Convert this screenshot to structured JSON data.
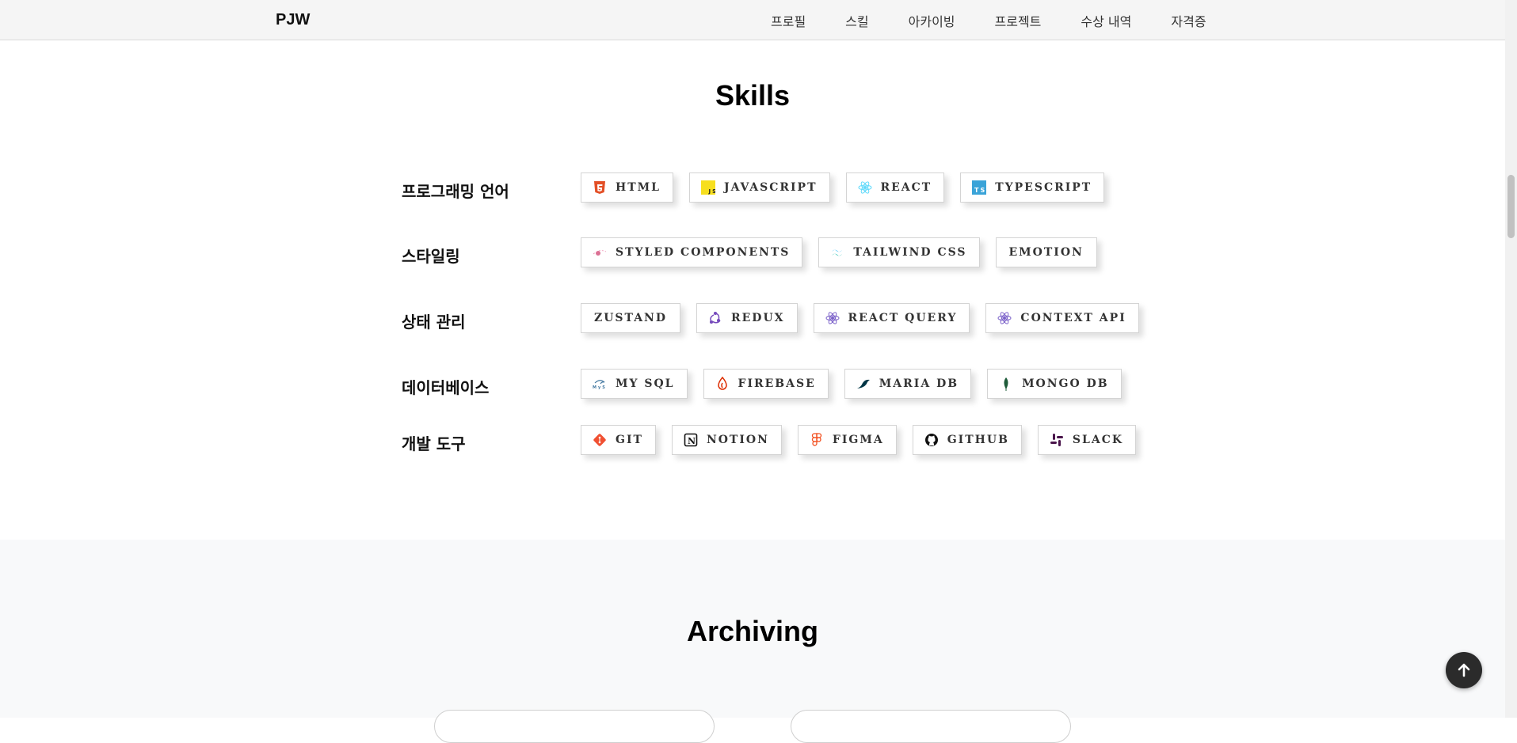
{
  "header": {
    "logo": "PJW",
    "nav": [
      "프로필",
      "스킬",
      "아카이빙",
      "프로젝트",
      "수상 내역",
      "자격증"
    ]
  },
  "skills": {
    "title": "Skills",
    "rows": [
      {
        "category": "프로그래밍 언어",
        "items": [
          {
            "label": "HTML",
            "icon": "html5-icon"
          },
          {
            "label": "JAVASCRIPT",
            "icon": "javascript-icon"
          },
          {
            "label": "REACT",
            "icon": "react-icon"
          },
          {
            "label": "TYPESCRIPT",
            "icon": "typescript-icon"
          }
        ]
      },
      {
        "category": "스타일링",
        "items": [
          {
            "label": "STYLED COMPONENTS",
            "icon": "styled-components-icon"
          },
          {
            "label": "TAILWIND CSS",
            "icon": "tailwind-icon"
          },
          {
            "label": "EMOTION",
            "icon": ""
          }
        ]
      },
      {
        "category": "상태 관리",
        "items": [
          {
            "label": "ZUSTAND",
            "icon": ""
          },
          {
            "label": "REDUX",
            "icon": "redux-icon"
          },
          {
            "label": "REACT QUERY",
            "icon": "react-query-icon"
          },
          {
            "label": "CONTEXT API",
            "icon": "react-query-icon"
          }
        ]
      },
      {
        "category": "데이터베이스",
        "items": [
          {
            "label": "MY SQL",
            "icon": "mysql-icon"
          },
          {
            "label": "FIREBASE",
            "icon": "firebase-icon"
          },
          {
            "label": "MARIA DB",
            "icon": "mariadb-icon"
          },
          {
            "label": "MONGO DB",
            "icon": "mongodb-icon"
          }
        ]
      },
      {
        "category": "개발 도구",
        "items": [
          {
            "label": "GIT",
            "icon": "git-icon"
          },
          {
            "label": "NOTION",
            "icon": "notion-icon"
          },
          {
            "label": "FIGMA",
            "icon": "figma-icon"
          },
          {
            "label": "GITHUB",
            "icon": "github-icon"
          },
          {
            "label": "SLACK",
            "icon": "slack-icon"
          }
        ]
      }
    ]
  },
  "archiving": {
    "title": "Archiving"
  },
  "colors": {
    "html5": "#e34f26",
    "javascript": "#f7df1e",
    "react": "#61dafb",
    "typescript": "#3178c6",
    "redux": "#764abc",
    "react_query": "#7b61c9",
    "tailwind": "#38bdf8",
    "styled": "#db7093",
    "firebase": "#dd2c00",
    "mariadb": "#003545",
    "mongodb": "#13aa52",
    "git": "#f05032",
    "figma": "#f24e1e",
    "slack": "#4a154b",
    "mysql": "#4479a1"
  }
}
